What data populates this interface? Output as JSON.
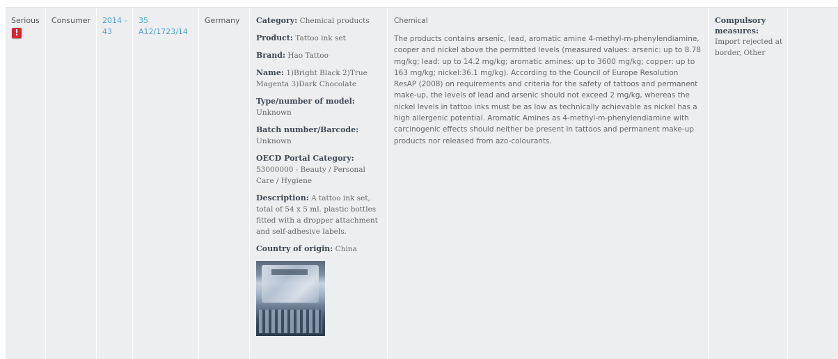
{
  "row": {
    "risk_level": "Serious",
    "risk_icon": "exclamation-icon",
    "risk_icon_glyph": "!",
    "product_user": "Consumer",
    "week": "2014 - 43",
    "reference": "35 A12/1723/14",
    "notifying_country": "Germany",
    "product": {
      "category_label": "Category:",
      "category": "Chemical products",
      "product_label": "Product:",
      "product": "Tattoo ink set",
      "brand_label": "Brand:",
      "brand": "Hao Tattoo",
      "name_label": "Name:",
      "name": "1)Bright Black 2)True Magenta 3)Dark Chocolate",
      "type_label": "Type/number of model:",
      "type": "Unknown",
      "batch_label": "Batch number/Barcode:",
      "batch": "Unknown",
      "oecd_label": "OECD Portal Category:",
      "oecd": "53000000 - Beauty / Personal Care / Hygiene",
      "description_label": "Description:",
      "description": "A tattoo ink set, total of 54 x 5 ml. plastic bottles fitted with a dropper attachment and self-adhesive labels.",
      "origin_label": "Country of origin:",
      "origin": "China",
      "photo_alt": "product photo"
    },
    "risk": {
      "type": "Chemical",
      "text": "The products contains arsenic, lead, aromatic amine 4-methyl-m-phenylendiamine, cooper and nickel above the permitted levels (measured values: arsenic: up to 8.78 mg/kg; lead: up to 14.2 mg/kg; aromatic amines: up to 3600 mg/kg; copper: up to 163 mg/kg; nickel:36.1 mg/kg). According to the Council of Europe Resolution ResAP (2008) on requirements and criteria for the safety of tattoos and permanent make-up, the levels of lead and arsenic should not exceed 2 mg/kg, whereas the nickel levels in tattoo inks must be as low as technically achievable as nickel has a high allergenic potential. Aromatic Amines as 4-methyl-m-phenylendiamine with carcinogenic effects should neither be present in tattoos and permanent make-up products nor released from azo-colourants."
    },
    "measures": {
      "label": "Compulsory measures:",
      "value": "Import rejected at border, Other"
    }
  },
  "colors": {
    "row_background": "#eceef0",
    "link": "#4aa3d6",
    "alert": "#d9262c",
    "label_text": "#3f4a57",
    "body_text": "#666666"
  }
}
